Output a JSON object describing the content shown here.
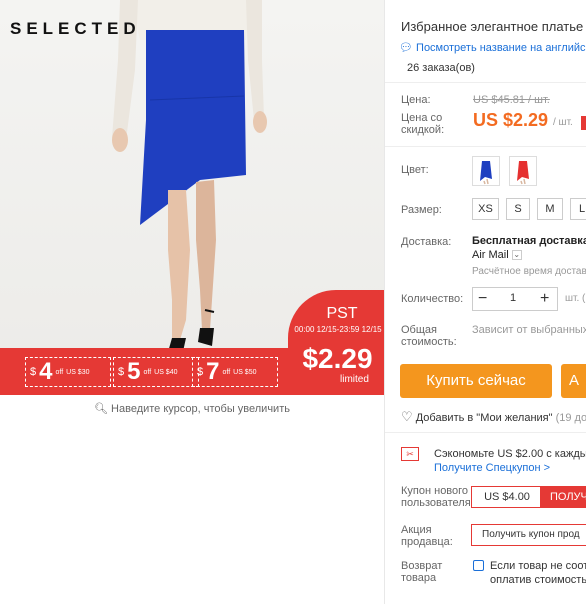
{
  "gallery": {
    "brand": "SELECTED",
    "coupons": [
      {
        "currency": "$",
        "amount": "4",
        "off": "off",
        "threshold": "US $30"
      },
      {
        "currency": "$",
        "amount": "5",
        "off": "off",
        "threshold": "US $40"
      },
      {
        "currency": "$",
        "amount": "7",
        "off": "off",
        "threshold": "US $50"
      }
    ],
    "badge": {
      "title": "PST",
      "time": "00:00 12/15-23:59 12/15",
      "price": "$2.29",
      "sub": "limited"
    },
    "zoom_hint": "Наведите курсор, чтобы увеличить"
  },
  "product": {
    "title": "Избранное элегантное платье д",
    "translate_link": "Посмотреть название на английск",
    "orders": "26 заказа(ов)"
  },
  "price": {
    "label": "Цена:",
    "old": "US $45.81 / шт.",
    "discount_label_1": "Цена со",
    "discount_label_2": "скидкой:",
    "new": "US $2.29",
    "unit": "/ шт."
  },
  "color": {
    "label": "Цвет:"
  },
  "size": {
    "label": "Размер:",
    "options": [
      "XS",
      "S",
      "M",
      "L"
    ]
  },
  "shipping": {
    "label": "Доставка:",
    "main": "Бесплатная доставка в",
    "method": "Air Mail",
    "time": "Расчётное время достав"
  },
  "quantity": {
    "label": "Количество:",
    "minus": "−",
    "value": "1",
    "plus": "+",
    "unit": "шт. ("
  },
  "total": {
    "label_1": "Общая",
    "label_2": "стоимость:",
    "note": "Зависит от выбранных"
  },
  "actions": {
    "buy": "Купить сейчас",
    "buy2": "А"
  },
  "wishlist": {
    "text": "Добавить в \"Мои желания\"",
    "count": "(19 доб"
  },
  "savings": {
    "text": "Сэкономьте US $2.00 с каждых",
    "link": "Получите Спецкупон >"
  },
  "new_user_coupon": {
    "label_1": "Купон нового",
    "label_2": "пользователя",
    "amount": "US $4.00",
    "button": "ПОЛУЧ"
  },
  "seller_promo": {
    "label_1": "Акция",
    "label_2": "продавца:",
    "button": "Получить купон прод"
  },
  "returns": {
    "label_1": "Возврат",
    "label_2": "товара",
    "line1": "Если товар не соотв",
    "line2": "оплатив стоимость"
  },
  "colors": {
    "accent_red": "#e53935",
    "orange": "#f36b21",
    "buy_button": "#f4961e",
    "link": "#1a6fd8",
    "skirt_blue": "#1f3fc0",
    "skirt_red": "#e53030"
  }
}
